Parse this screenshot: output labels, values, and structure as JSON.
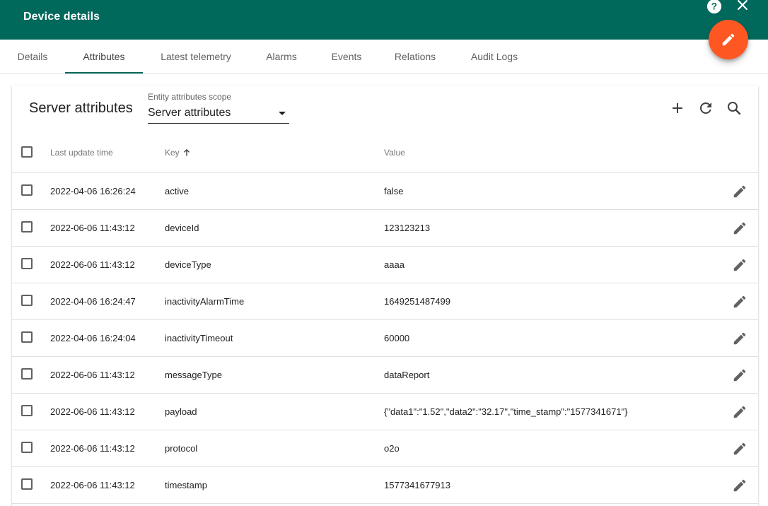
{
  "header": {
    "title": "Device details",
    "help_icon": "help-circle-icon",
    "close_icon": "close-icon",
    "fab_icon": "edit-pencil-icon"
  },
  "tabs": [
    {
      "label": "Details"
    },
    {
      "label": "Attributes"
    },
    {
      "label": "Latest telemetry"
    },
    {
      "label": "Alarms"
    },
    {
      "label": "Events"
    },
    {
      "label": "Relations"
    },
    {
      "label": "Audit Logs"
    }
  ],
  "active_tab": "Attributes",
  "card": {
    "title": "Server attributes",
    "scope_label": "Entity attributes scope",
    "scope_value": "Server attributes",
    "actions": [
      "add-icon",
      "refresh-icon",
      "search-icon"
    ]
  },
  "table": {
    "columns": {
      "time": "Last update time",
      "key": "Key",
      "value": "Value"
    },
    "sort": {
      "column": "Key",
      "direction": "ascending"
    },
    "rows": [
      {
        "time": "2022-04-06 16:26:24",
        "key": "active",
        "value": "false"
      },
      {
        "time": "2022-06-06 11:43:12",
        "key": "deviceId",
        "value": "123123213"
      },
      {
        "time": "2022-06-06 11:43:12",
        "key": "deviceType",
        "value": "aaaa"
      },
      {
        "time": "2022-04-06 16:24:47",
        "key": "inactivityAlarmTime",
        "value": "1649251487499"
      },
      {
        "time": "2022-04-06 16:24:04",
        "key": "inactivityTimeout",
        "value": "60000"
      },
      {
        "time": "2022-06-06 11:43:12",
        "key": "messageType",
        "value": "dataReport"
      },
      {
        "time": "2022-06-06 11:43:12",
        "key": "payload",
        "value": "{\"data1\":\"1.52\",\"data2\":\"32.17\",\"time_stamp\":\"1577341671\"}"
      },
      {
        "time": "2022-06-06 11:43:12",
        "key": "protocol",
        "value": "o2o"
      },
      {
        "time": "2022-06-06 11:43:12",
        "key": "timestamp",
        "value": "1577341677913"
      }
    ]
  },
  "colors": {
    "header_bg": "#00695c",
    "tab_ink": "#00695c",
    "fab_bg": "#ff5722"
  }
}
